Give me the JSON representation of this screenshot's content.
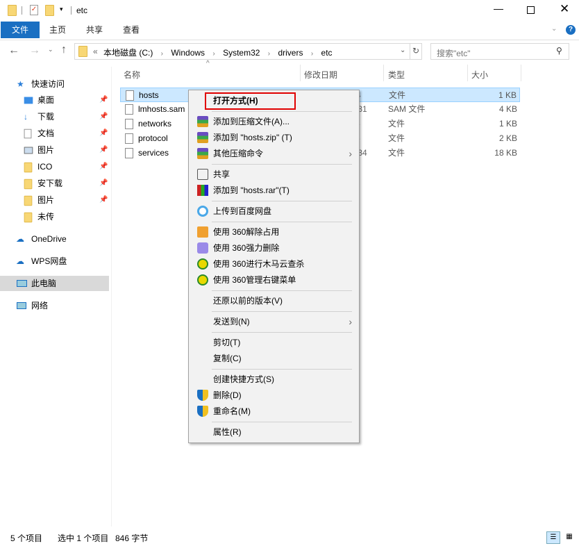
{
  "window": {
    "title": "etc"
  },
  "ribbon": {
    "tabs": [
      "文件",
      "主页",
      "共享",
      "查看"
    ],
    "accent": "#1a6fc2"
  },
  "address": {
    "crumbs": [
      "本地磁盘 (C:)",
      "Windows",
      "System32",
      "drivers",
      "etc"
    ],
    "overflow": "«",
    "search_placeholder": "搜索\"etc\""
  },
  "nav": {
    "items": [
      {
        "label": "快速访问",
        "icon": "star-icon"
      },
      {
        "label": "桌面",
        "icon": "desktop-icon",
        "pinned": true
      },
      {
        "label": "下载",
        "icon": "download-icon",
        "pinned": true
      },
      {
        "label": "文档",
        "icon": "document-icon",
        "pinned": true
      },
      {
        "label": "图片",
        "icon": "picture-icon",
        "pinned": true
      },
      {
        "label": "ICO",
        "icon": "folder-icon",
        "pinned": true
      },
      {
        "label": "安下载",
        "icon": "folder-icon",
        "pinned": true
      },
      {
        "label": "图片",
        "icon": "folder-icon",
        "pinned": true
      },
      {
        "label": "未传",
        "icon": "folder-icon"
      },
      {
        "label": "OneDrive",
        "icon": "cloud-icon"
      },
      {
        "label": "WPS网盘",
        "icon": "cloud-icon"
      },
      {
        "label": "此电脑",
        "icon": "computer-icon",
        "selected": true
      },
      {
        "label": "网络",
        "icon": "network-icon"
      }
    ]
  },
  "columns": [
    "名称",
    "修改日期",
    "类型",
    "大小"
  ],
  "files": [
    {
      "name": "hosts",
      "date": "4",
      "type": "文件",
      "size": "1 KB",
      "selected": true
    },
    {
      "name": "lmhosts.sam",
      "date": ":31",
      "type": "SAM 文件",
      "size": "4 KB"
    },
    {
      "name": "networks",
      "date": "6",
      "type": "文件",
      "size": "1 KB"
    },
    {
      "name": "protocol",
      "date": "6",
      "type": "文件",
      "size": "2 KB"
    },
    {
      "name": "services",
      "date": ":34",
      "type": "文件",
      "size": "18 KB"
    }
  ],
  "context_menu": {
    "items": [
      {
        "label": "打开方式(H)",
        "bold": true,
        "highlight": "#e00000"
      },
      {
        "sep": true
      },
      {
        "label": "添加到压缩文件(A)...",
        "icon": "winrar-icon"
      },
      {
        "label": "添加到 \"hosts.zip\" (T)",
        "icon": "winrar-icon"
      },
      {
        "label": "其他压缩命令",
        "icon": "winrar-icon",
        "submenu": true
      },
      {
        "sep": true
      },
      {
        "label": "共享",
        "icon": "share-icon"
      },
      {
        "label": "添加到 \"hosts.rar\"(T)",
        "icon": "rar-icon"
      },
      {
        "sep": true
      },
      {
        "label": "上传到百度网盘",
        "icon": "baidu-icon"
      },
      {
        "sep": true
      },
      {
        "label": "使用 360解除占用",
        "icon": "360-unlock-icon"
      },
      {
        "label": "使用 360强力删除",
        "icon": "360-shred-icon"
      },
      {
        "label": "使用 360进行木马云查杀",
        "icon": "360-scan-icon"
      },
      {
        "label": "使用 360管理右键菜单",
        "icon": "360-menu-icon"
      },
      {
        "sep": true
      },
      {
        "label": "还原以前的版本(V)"
      },
      {
        "sep": true
      },
      {
        "label": "发送到(N)",
        "submenu": true
      },
      {
        "sep": true
      },
      {
        "label": "剪切(T)"
      },
      {
        "label": "复制(C)"
      },
      {
        "sep": true
      },
      {
        "label": "创建快捷方式(S)"
      },
      {
        "label": "删除(D)",
        "icon": "shield-icon"
      },
      {
        "label": "重命名(M)",
        "icon": "shield-icon"
      },
      {
        "sep": true
      },
      {
        "label": "属性(R)"
      }
    ]
  },
  "status": {
    "count": "5 个项目",
    "selected": "选中 1 个项目",
    "size": "846 字节"
  }
}
